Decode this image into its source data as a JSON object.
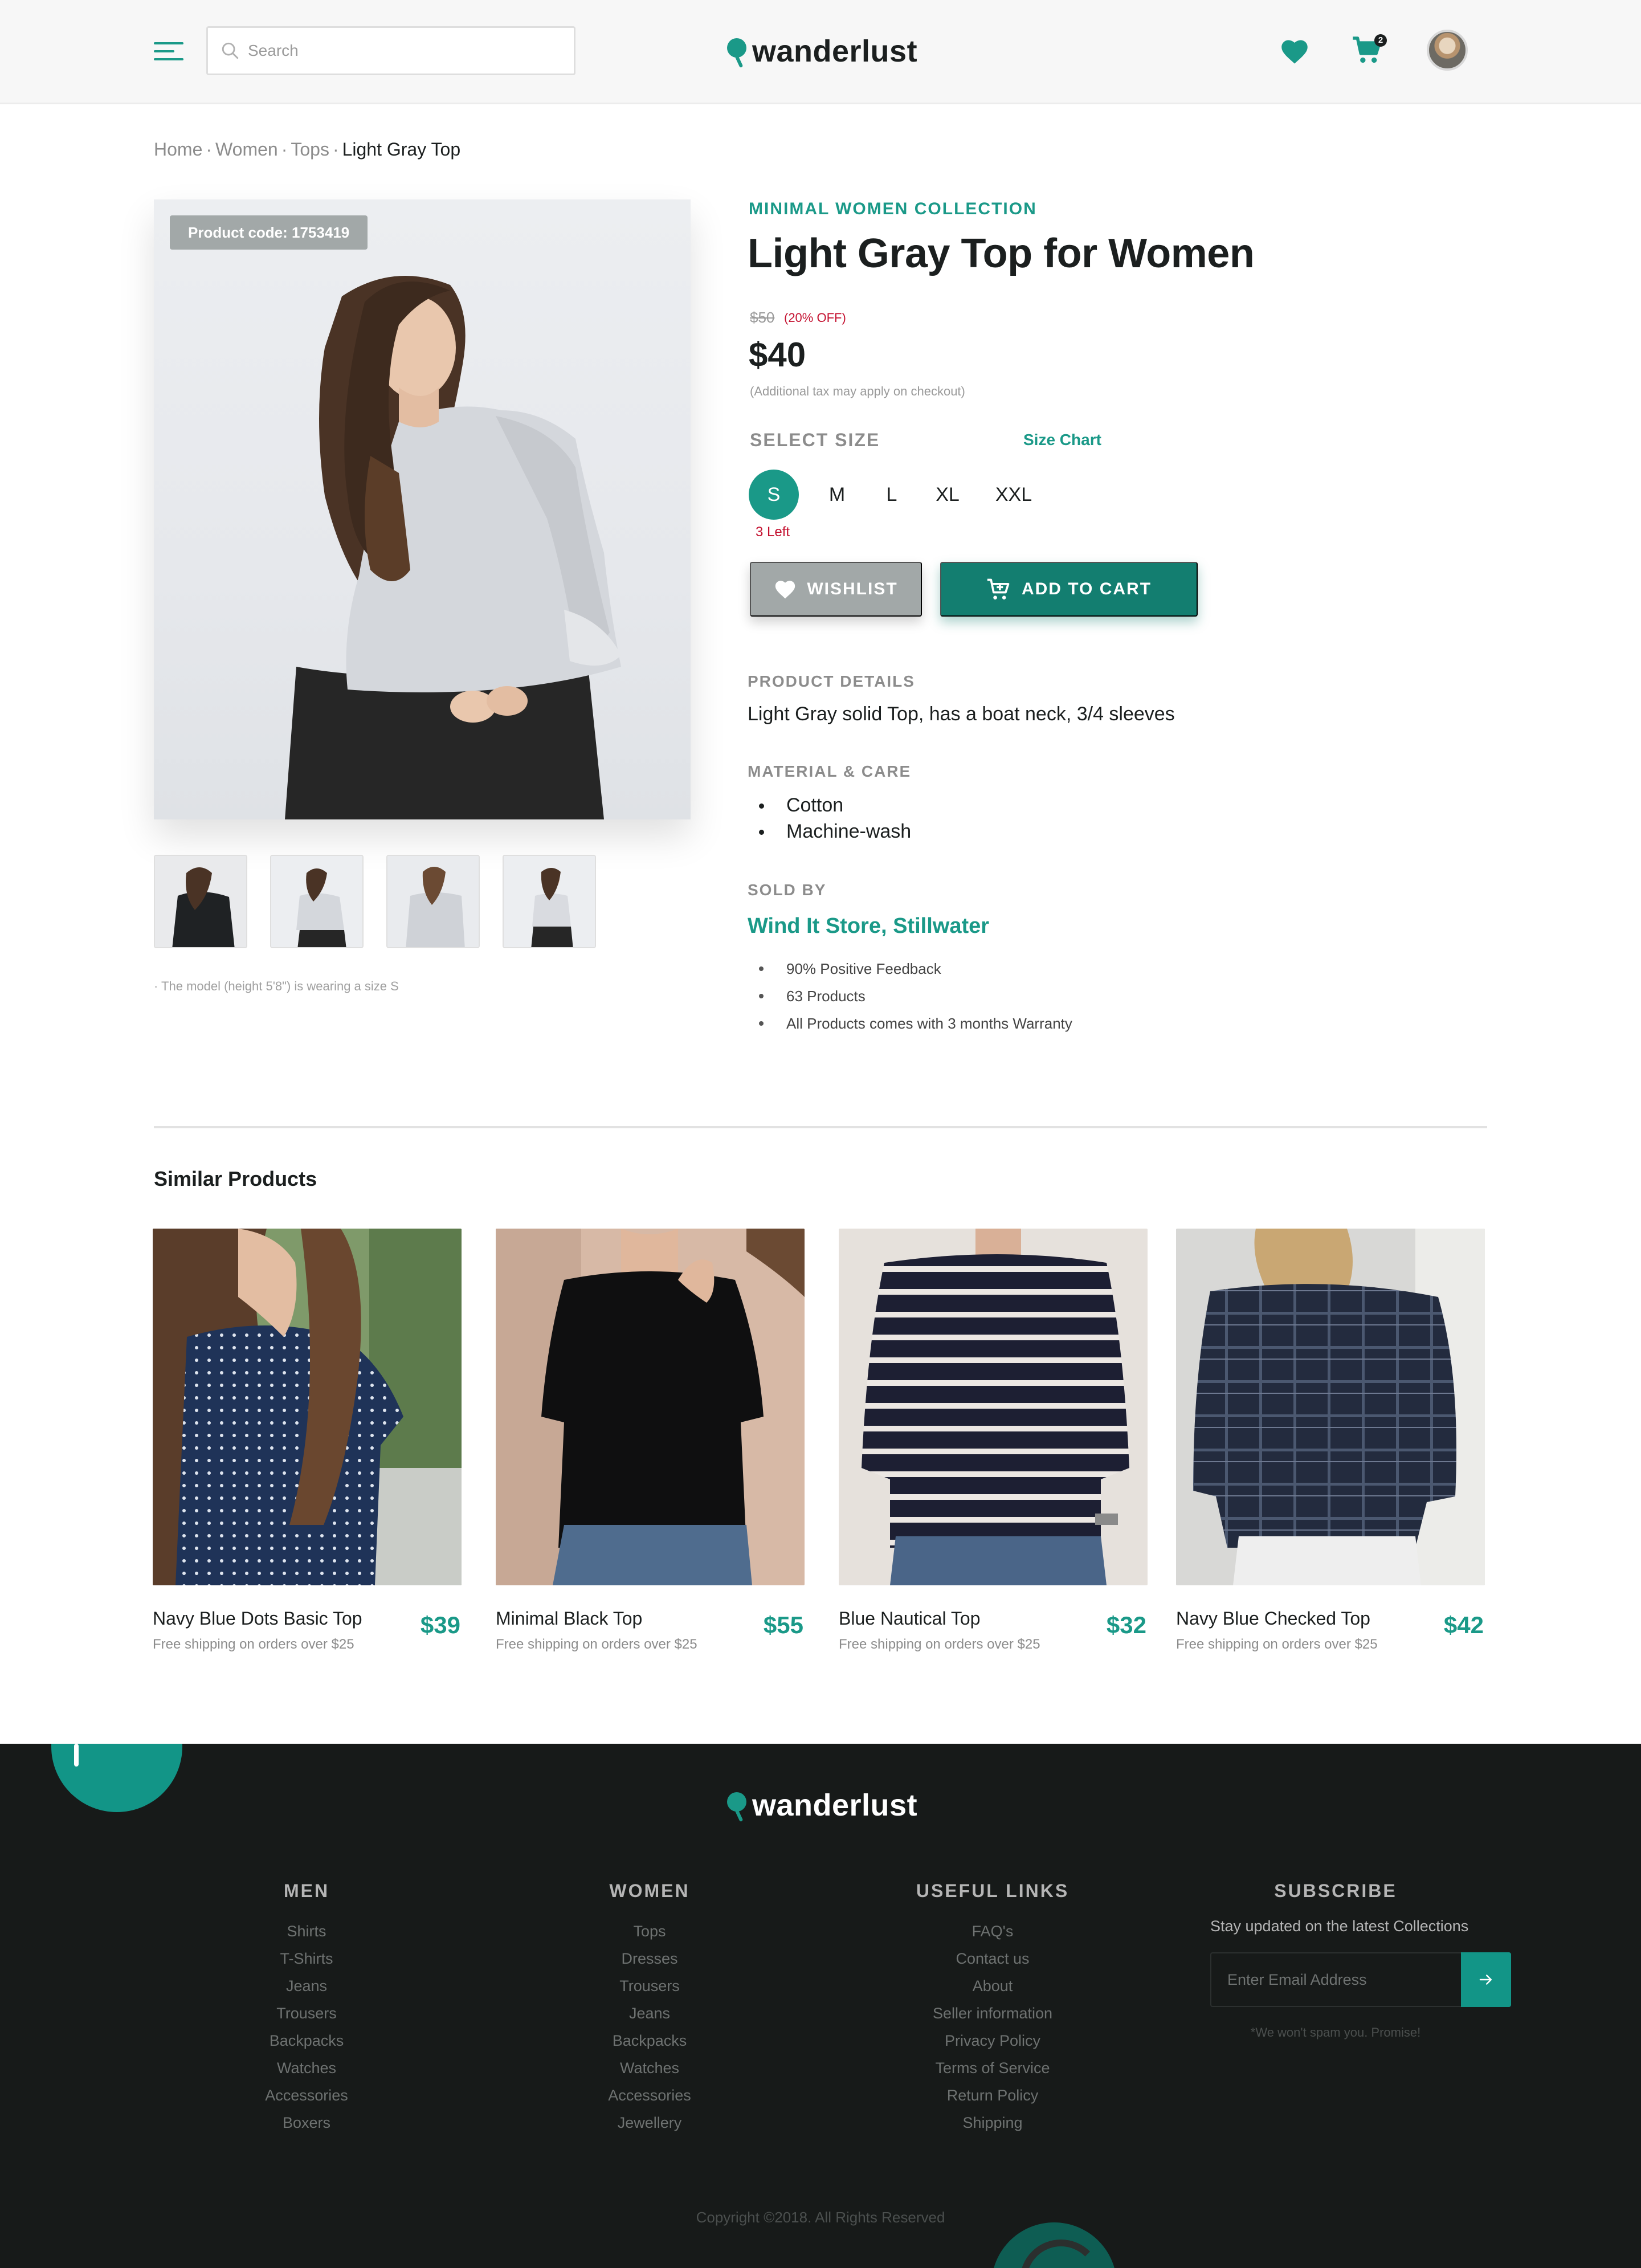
{
  "header": {
    "search_placeholder": "Search",
    "brand": "wanderlust",
    "cart_count": "2",
    "icons": {
      "menu": "hamburger-menu-icon",
      "search": "search-icon",
      "wishlist": "heart-icon",
      "cart": "cart-icon",
      "avatar": "user-avatar"
    }
  },
  "breadcrumb": {
    "items": [
      "Home",
      "Women",
      "Tops"
    ],
    "separator": "·",
    "current": "Light Gray Top"
  },
  "gallery": {
    "product_code": "Product code: 1753419",
    "thumbnail_count": 4,
    "note": "· The model (height 5'8\") is wearing a size S"
  },
  "product": {
    "collection": "MINIMAL WOMEN COLLECTION",
    "title": "Light Gray Top for Women",
    "old_price": "$50",
    "discount": "(20% OFF)",
    "price": "$40",
    "tax_note": "(Additional tax may apply on checkout)",
    "select_size_label": "SELECT SIZE",
    "size_chart_label": "Size Chart",
    "sizes": [
      "S",
      "M",
      "L",
      "XL",
      "XXL"
    ],
    "selected_size": "S",
    "stock_note": "3 Left",
    "wishlist_label": "WISHLIST",
    "add_to_cart_label": "ADD TO CART",
    "details_label": "PRODUCT DETAILS",
    "details_text": "Light Gray solid Top, has a boat neck, 3/4 sleeves",
    "material_label": "MATERIAL & CARE",
    "material_items": [
      "Cotton",
      "Machine-wash"
    ],
    "sold_by_label": "SOLD BY",
    "seller_name": "Wind It Store, Stillwater",
    "seller_points": [
      "90% Positive Feedback",
      "63 Products",
      "All Products comes with 3 months Warranty"
    ]
  },
  "similar": {
    "title": "Similar Products",
    "items": [
      {
        "name": "Navy Blue Dots Basic Top",
        "shipping": "Free shipping on orders over $25",
        "price": "$39"
      },
      {
        "name": "Minimal Black Top",
        "shipping": "Free shipping on orders over $25",
        "price": "$55"
      },
      {
        "name": "Blue Nautical Top",
        "shipping": "Free shipping on orders over $25",
        "price": "$32"
      },
      {
        "name": "Navy Blue Checked Top",
        "shipping": "Free shipping on orders over $25",
        "price": "$42"
      }
    ]
  },
  "footer": {
    "brand": "wanderlust",
    "columns": [
      {
        "title": "MEN",
        "links": [
          "Shirts",
          "T-Shirts",
          "Jeans",
          "Trousers",
          "Backpacks",
          "Watches",
          "Accessories",
          "Boxers"
        ]
      },
      {
        "title": "WOMEN",
        "links": [
          "Tops",
          "Dresses",
          "Trousers",
          "Jeans",
          "Backpacks",
          "Watches",
          "Accessories",
          "Jewellery"
        ]
      },
      {
        "title": "USEFUL LINKS",
        "links": [
          "FAQ's",
          "Contact us",
          "About",
          "Seller information",
          "Privacy Policy",
          "Terms of Service",
          "Return Policy",
          "Shipping"
        ]
      }
    ],
    "subscribe": {
      "title": "SUBSCRIBE",
      "text": "Stay updated on the latest Collections",
      "placeholder": "Enter Email Address",
      "note": "*We won't spam you. Promise!"
    },
    "copyright": "Copyright ©2018. All Rights Reserved"
  },
  "colors": {
    "accent": "#1a9988",
    "accent_dark": "#137e70",
    "sale_red": "#c4102f",
    "footer_bg": "#171a19",
    "header_bg": "#f7f7f7"
  }
}
